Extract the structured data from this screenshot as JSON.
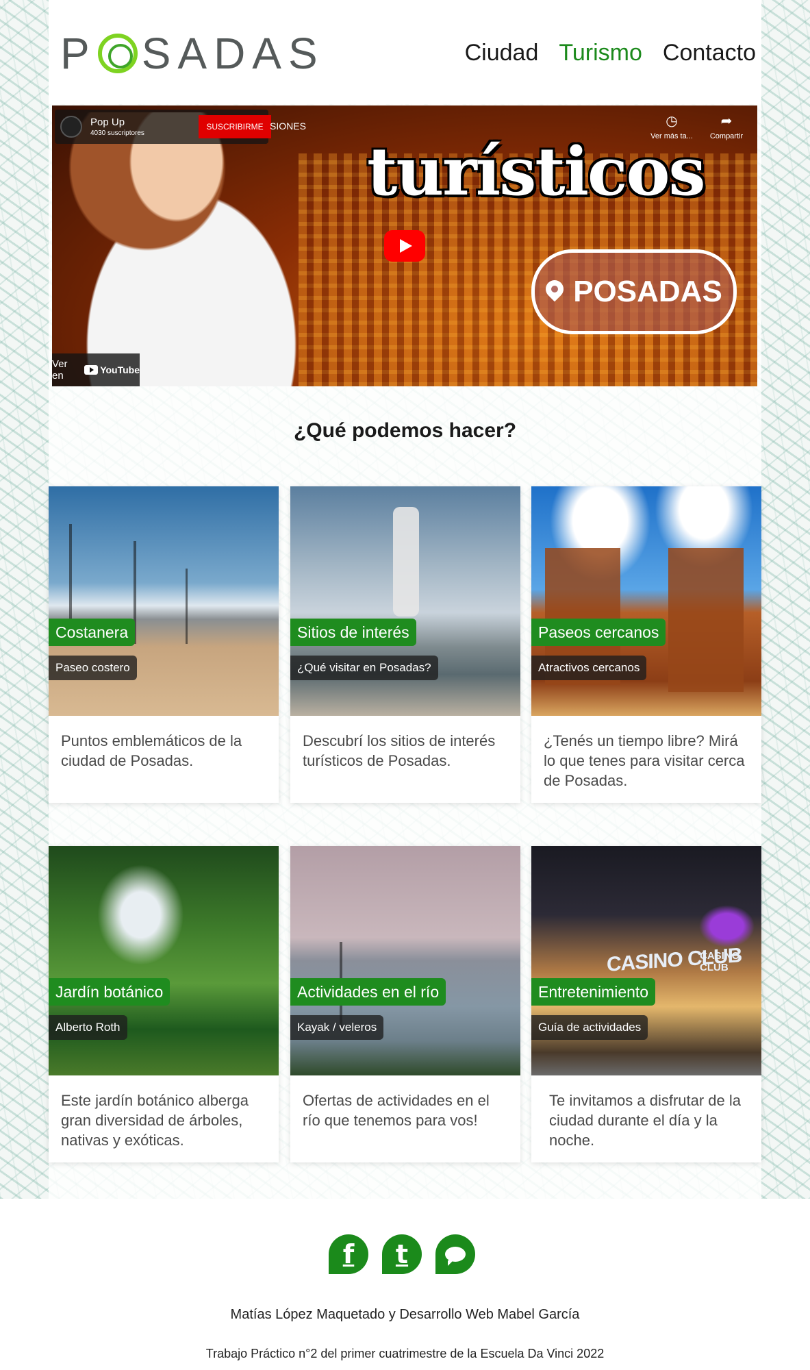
{
  "brand": {
    "logo_text": "POSADAS",
    "accent": "#1f8c1f"
  },
  "nav": {
    "items": [
      {
        "label": "Ciudad",
        "active": false
      },
      {
        "label": "Turismo",
        "active": true
      },
      {
        "label": "Contacto",
        "active": false
      }
    ]
  },
  "video": {
    "channel_name": "Pop Up",
    "channel_subs": "4030 suscriptores",
    "subscribe_label": "SUSCRIBIRME",
    "partial_title": "SIONES",
    "headline": "turísticos",
    "badge": "POSADAS",
    "watch_later": "Ver más ta...",
    "share": "Compartir",
    "watch_on": "Ver en",
    "youtube": "YouTube"
  },
  "section": {
    "title": "¿Qué podemos hacer?"
  },
  "cards": [
    {
      "tag": "Costanera",
      "sub": "Paseo costero",
      "text": "Puntos emblemáticos de la ciudad de Posadas."
    },
    {
      "tag": "Sitios de interés",
      "sub": "¿Qué visitar en Posadas?",
      "text": "Descubrí los sitios de interés turísticos de Posadas."
    },
    {
      "tag": "Paseos cercanos",
      "sub": "Atractivos cercanos",
      "text": "¿Tenés un tiempo libre? Mirá lo que tenes para visitar cerca de Posadas."
    },
    {
      "tag": "Jardín botánico",
      "sub": "Alberto Roth",
      "text": "Este jardín botánico alberga gran diversidad de árboles, nativas y exóticas."
    },
    {
      "tag": "Actividades en el río",
      "sub": "Kayak / veleros",
      "text": "Ofertas de actividades en el río que tenemos para vos!"
    },
    {
      "tag": "Entretenimiento",
      "sub": "Guía de actividades",
      "text": "Te invitamos a disfrutar de la ciudad durante el día y la noche.",
      "sign": "CASINO CLUB",
      "sign_small": "CASINO CLUB"
    }
  ],
  "footer": {
    "social": [
      {
        "icon": "facebook-icon",
        "glyph": "f"
      },
      {
        "icon": "twitter-icon",
        "glyph": "t"
      },
      {
        "icon": "chat-icon",
        "glyph": ""
      }
    ],
    "credits": "Matías López Maquetado y Desarrollo Web Mabel García",
    "note": "Trabajo Práctico n°2 del primer cuatrimestre de la Escuela Da Vinci 2022"
  }
}
